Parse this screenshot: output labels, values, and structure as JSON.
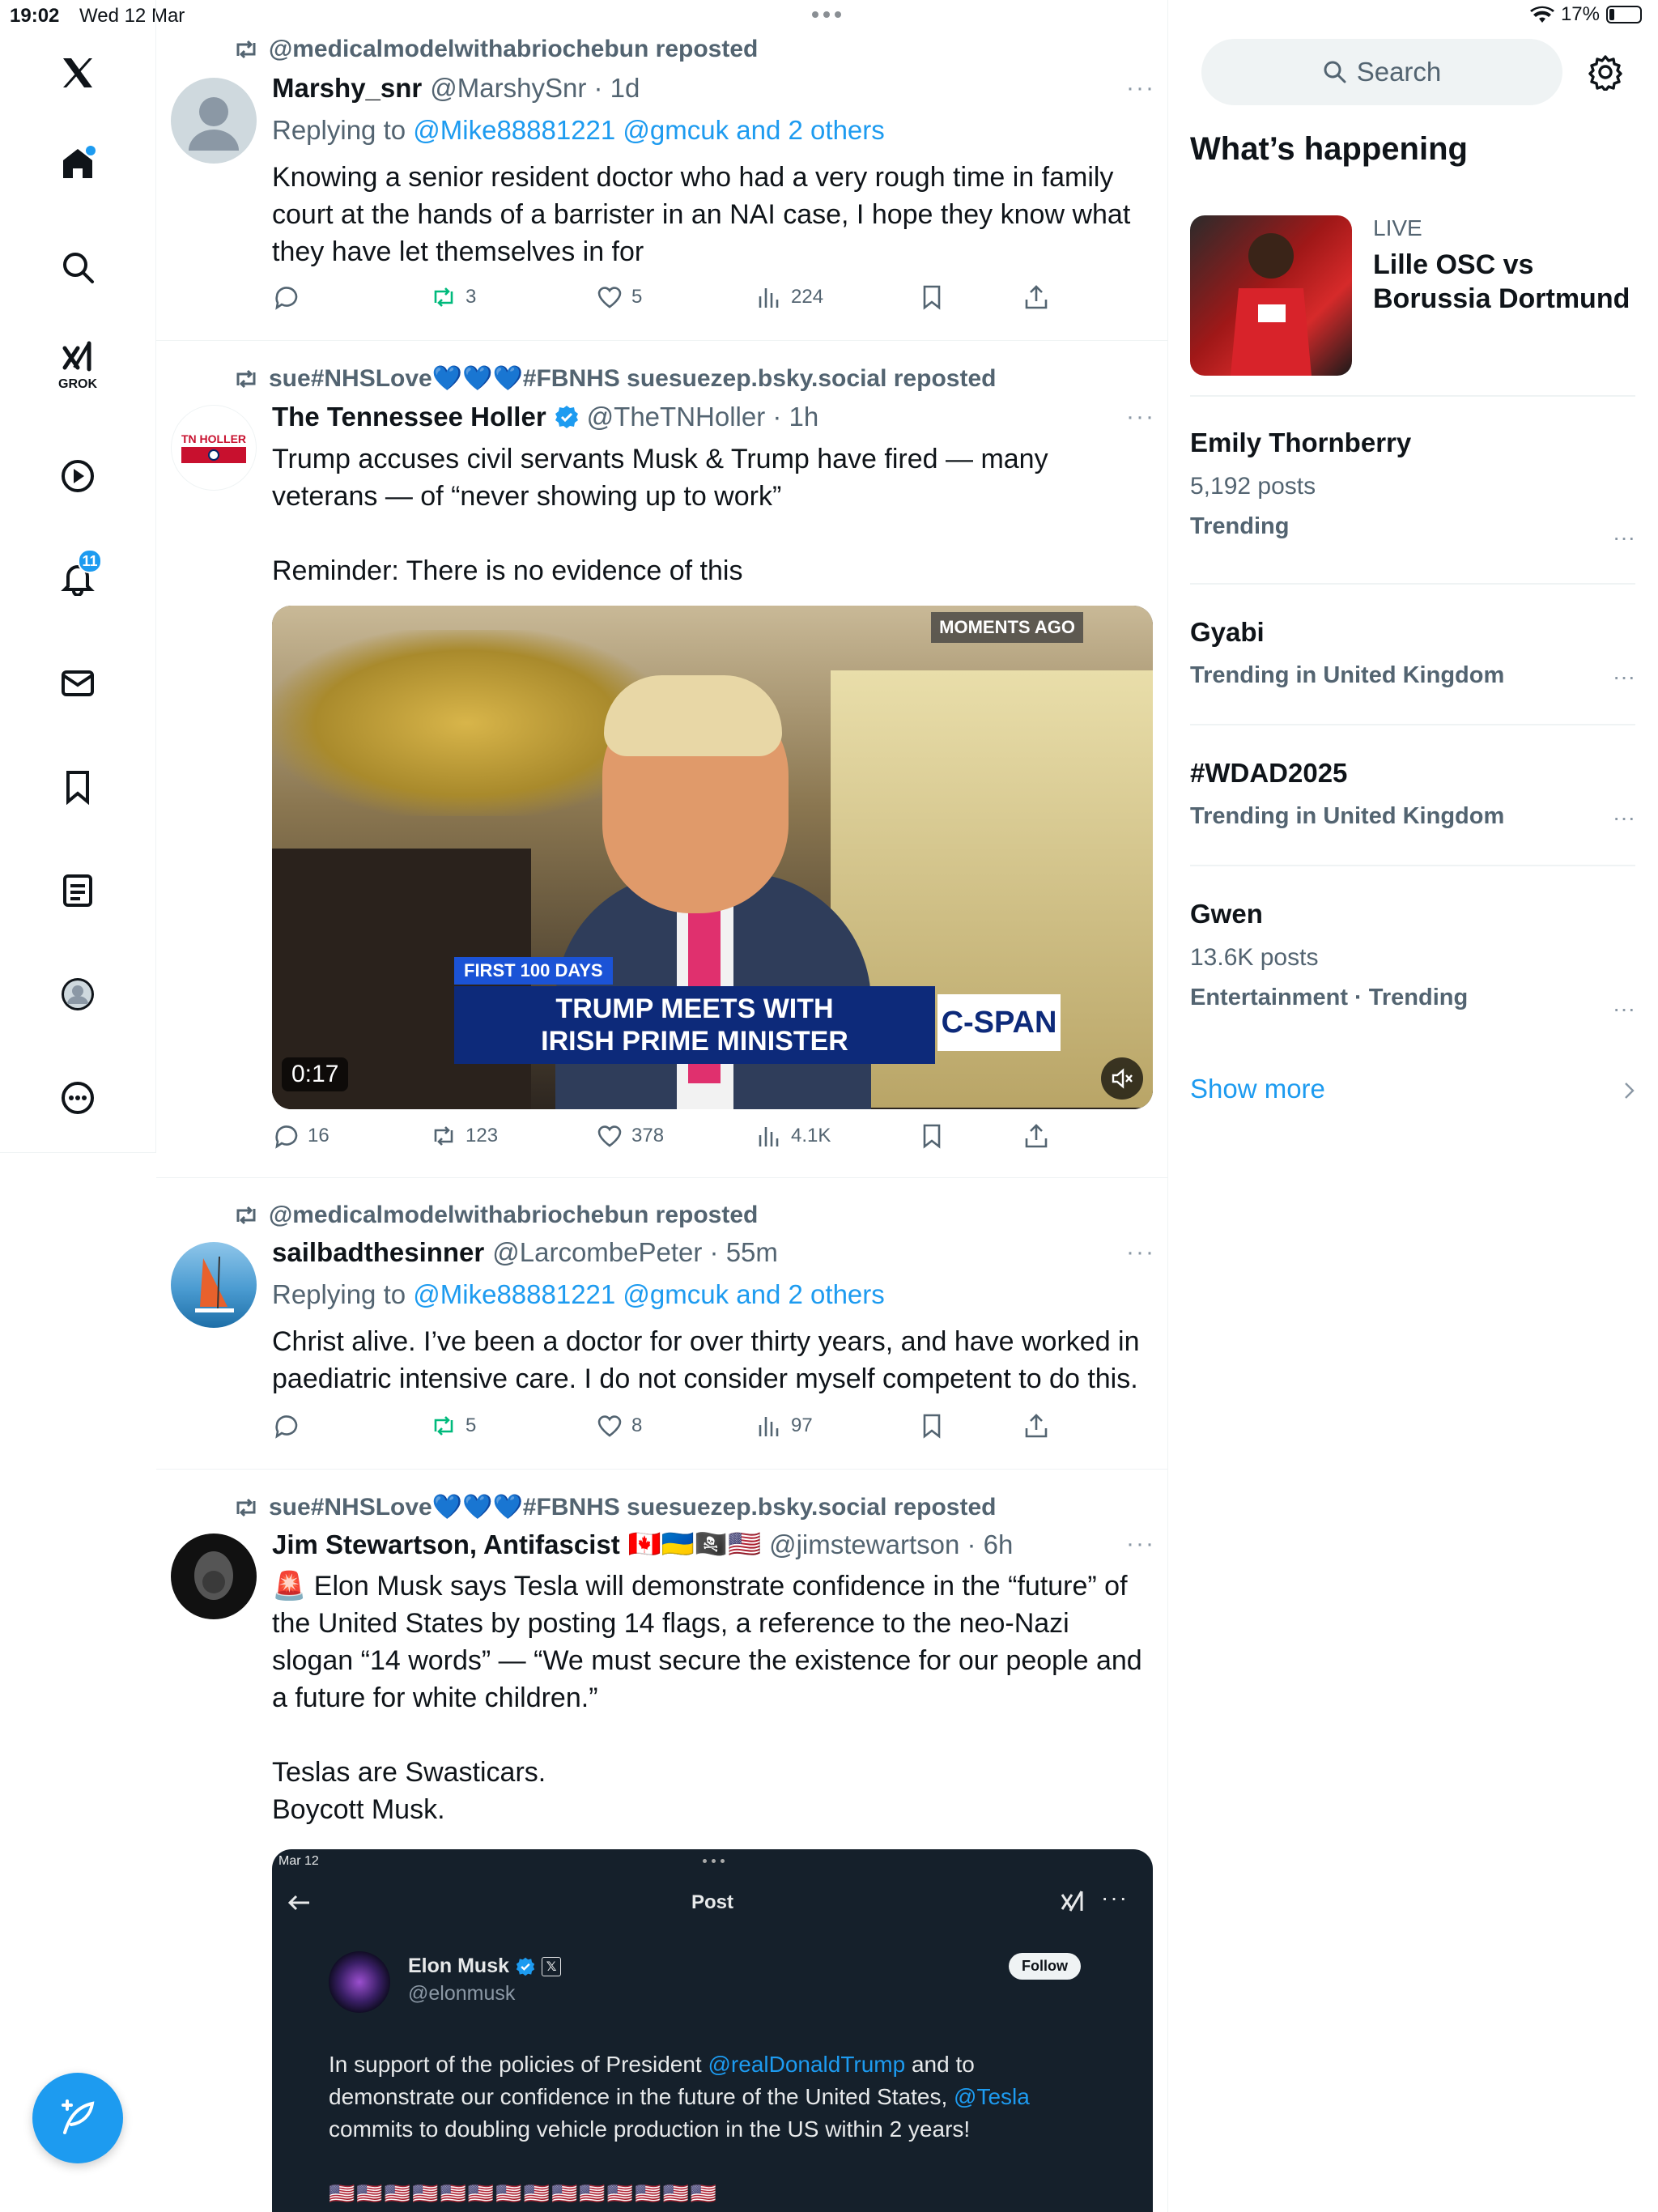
{
  "status_bar": {
    "time": "19:02",
    "date": "Wed 12 Mar",
    "battery": "17%"
  },
  "nav": {
    "grok_label": "GROK",
    "notifications_badge": "11"
  },
  "tweets": [
    {
      "repost_by": "@medicalmodelwithabriochebun reposted",
      "name": "Marshy_snr",
      "handle": "@MarshySnr · 1d",
      "reply_prefix": "Replying to ",
      "reply_to": "@Mike88881221 @gmcuk and 2 others",
      "body": "Knowing a senior resident doctor who had a very rough time in family court at the hands of a barrister in an NAI case, I hope they know what they have let themselves in for",
      "replies": "",
      "reposts": "3",
      "likes": "5",
      "views": "224"
    },
    {
      "repost_by": "sue#NHSLove💙💙💙#FBNHS suesuezep.bsky.social reposted",
      "name": "The Tennessee Holler",
      "handle": "@TheTNHoller · 1h",
      "avatar_text": "TN HOLLER",
      "body_line1": "Trump accuses civil servants Musk & Trump have fired — many veterans — of “never showing up to work”",
      "body_line2": "Reminder: There is no evidence of this",
      "video": {
        "moments": "MOMENTS AGO",
        "lower_third_tag": "FIRST 100 DAYS",
        "headline_1": "TRUMP MEETS WITH",
        "headline_2": "IRISH PRIME MINISTER",
        "network": "C-SPAN",
        "duration": "0:17"
      },
      "replies": "16",
      "reposts": "123",
      "likes": "378",
      "views": "4.1K"
    },
    {
      "repost_by": "@medicalmodelwithabriochebun reposted",
      "name": "sailbadthesinner",
      "handle": "@LarcombePeter · 55m",
      "reply_prefix": "Replying to ",
      "reply_to": "@Mike88881221 @gmcuk and 2 others",
      "body": "Christ alive. I’ve been a doctor for over thirty years, and have worked in paediatric intensive care. I do not consider myself competent to do this.",
      "replies": "",
      "reposts": "5",
      "likes": "8",
      "views": "97"
    },
    {
      "repost_by": "sue#NHSLove💙💙💙#FBNHS suesuezep.bsky.social reposted",
      "name": "Jim Stewartson, Antifascist",
      "flags": "🇨🇦🇺🇦🏴‍☠️🇺🇸",
      "handle": "@jimstewartson · 6h",
      "body_line1": "🚨 Elon Musk says Tesla will demonstrate confidence in the “future” of the United States by posting 14 flags, a reference to the neo-Nazi slogan “14 words” — “We must secure the existence for our people and a future for white children.”",
      "body_line2": "Teslas are Swasticars.",
      "body_line3": "Boycott Musk.",
      "embed": {
        "date": "Mar 12",
        "title": "Post",
        "name": "Elon Musk",
        "handle": "@elonmusk",
        "follow": "Follow",
        "text_1": "In support of the policies of President ",
        "mention_1": "@realDonaldTrump",
        "text_2": " and to demonstrate our confidence in the future of the United States, ",
        "mention_2": "@Tesla",
        "text_3": " commits to doubling vehicle production in the US within 2 years!",
        "flags": "🇺🇸🇺🇸🇺🇸🇺🇸🇺🇸🇺🇸🇺🇸🇺🇸🇺🇸🇺🇸🇺🇸🇺🇸🇺🇸🇺🇸"
      }
    }
  ],
  "right": {
    "search_placeholder": "Search",
    "heading": "What’s happening",
    "live": {
      "tag": "LIVE",
      "title": "Lille OSC vs Borussia Dortmund"
    },
    "trends": [
      {
        "title": "Emily Thornberry",
        "count": "5,192 posts",
        "meta": "Trending"
      },
      {
        "title": "Gyabi",
        "count": "",
        "meta": "Trending in United Kingdom"
      },
      {
        "title": "#WDAD2025",
        "count": "",
        "meta": "Trending in United Kingdom"
      },
      {
        "title": "Gwen",
        "count": "13.6K posts",
        "meta": "Entertainment · Trending"
      }
    ],
    "show_more": "Show more"
  },
  "icons": [
    "x-logo-icon",
    "home-icon",
    "search-icon",
    "grok-icon",
    "video-icon",
    "bell-icon",
    "mail-icon",
    "bookmark-icon",
    "list-icon",
    "profile-icon",
    "more-icon",
    "compose-icon",
    "gear-icon"
  ]
}
